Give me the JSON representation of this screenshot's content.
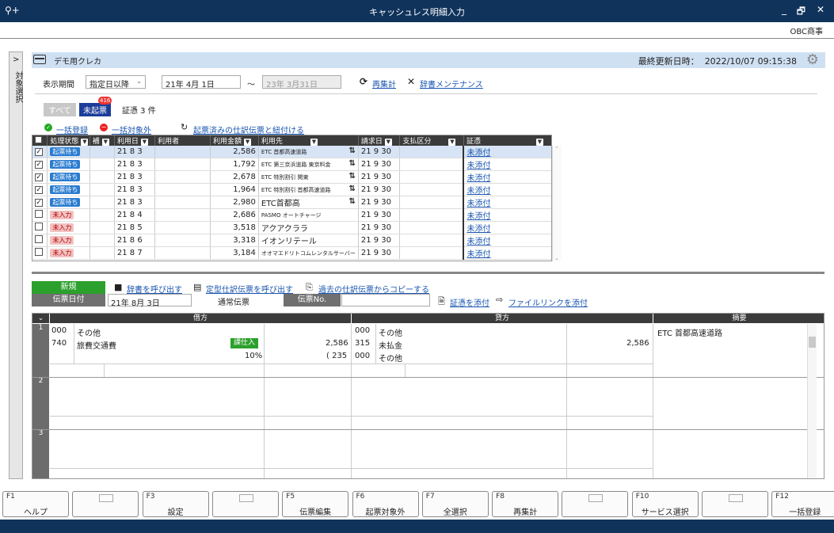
{
  "window": {
    "title": "キャッシュレス明細入力",
    "key_icon": "⚲+",
    "min": "_",
    "max": "🗗",
    "close": "✕"
  },
  "company": "OBC商事",
  "left_panel": {
    "chevron": ">",
    "label": "対象選択"
  },
  "header": {
    "card_name": "デモ用クレカ",
    "updated_label": "最終更新日時：",
    "updated_value": "2022/10/07 09:15:38"
  },
  "filter": {
    "period_label": "表示期間",
    "period_select": "指定日以降",
    "date_from": "21年 4月 1日",
    "tilde": "～",
    "date_to": "23年 3月31日",
    "recalc": "再集計",
    "dict": "辞書メンテナンス"
  },
  "status_tabs": {
    "all": "すべて",
    "unposted": "未起票",
    "unposted_count": "416",
    "evidence": "証憑 3 件"
  },
  "actions": {
    "bulk_register": "一括登録",
    "bulk_exclude": "一括対象外",
    "link_slip": "起票済みの仕訳伝票と紐付ける"
  },
  "grid": {
    "headers": [
      "処理状態",
      "補",
      "利用日",
      "利用者",
      "利用金額",
      "利用先",
      "請求日",
      "支払区分",
      "証憑"
    ],
    "rows": [
      {
        "checked": true,
        "status": "起票待ち",
        "st": "blue",
        "date": "21  8  3",
        "amount": "2,586",
        "payee": "ETC 首都高速道路",
        "sync": true,
        "bill": "21  9 30",
        "ev": "未添付"
      },
      {
        "checked": true,
        "status": "起票待ち",
        "st": "blue",
        "date": "21  8  3",
        "amount": "1,792",
        "payee": "ETC 第三京浜道路 東京料金",
        "sync": true,
        "bill": "21  9 30",
        "ev": "未添付"
      },
      {
        "checked": true,
        "status": "起票待ち",
        "st": "blue",
        "date": "21  8  3",
        "amount": "2,678",
        "payee": "ETC 特別割引 関東",
        "sync": true,
        "bill": "21  9 30",
        "ev": "未添付"
      },
      {
        "checked": true,
        "status": "起票待ち",
        "st": "blue",
        "date": "21  8  3",
        "amount": "1,964",
        "payee": "ETC 特別割引 首都高速道路",
        "sync": true,
        "bill": "21  9 30",
        "ev": "未添付"
      },
      {
        "checked": true,
        "status": "起票待ち",
        "st": "blue",
        "date": "21  8  3",
        "amount": "2,980",
        "payee": "ETC首都高",
        "sync": true,
        "bill": "21  9 30",
        "ev": "未添付"
      },
      {
        "checked": false,
        "status": "未入力",
        "st": "red",
        "date": "21  8  4",
        "amount": "2,686",
        "payee": "PASMO オートチャージ",
        "sync": false,
        "bill": "21  9 30",
        "ev": "未添付"
      },
      {
        "checked": false,
        "status": "未入力",
        "st": "red",
        "date": "21  8  5",
        "amount": "3,518",
        "payee": "アクアクララ",
        "sync": false,
        "bill": "21  9 30",
        "ev": "未添付"
      },
      {
        "checked": false,
        "status": "未入力",
        "st": "red",
        "date": "21  8  6",
        "amount": "3,318",
        "payee": "イオンリテール",
        "sync": false,
        "bill": "21  9 30",
        "ev": "未添付"
      },
      {
        "checked": false,
        "status": "未入力",
        "st": "red",
        "date": "21  8  7",
        "amount": "3,184",
        "payee": "オオマエドリトコムレンタルサーバー",
        "sync": false,
        "bill": "21  9 30",
        "ev": "未添付"
      }
    ]
  },
  "slip": {
    "new": "新規",
    "call_dict": "辞書を呼び出す",
    "call_template": "定型仕訳伝票を呼び出す",
    "copy_past": "過去の仕訳伝票からコピーする",
    "date_label": "伝票日付",
    "date_value": "21年 8月 3日",
    "type": "通常伝票",
    "no_label": "伝票No.",
    "attach_evidence": "証憑を添付",
    "attach_link": "ファイルリンクを添付"
  },
  "journal": {
    "headers": {
      "debit": "借方",
      "credit": "貸方",
      "memo": "摘要"
    },
    "row1": {
      "dr_code1": "000",
      "dr_name1": "その他",
      "dr_code2": "740",
      "dr_name2": "旅費交通費",
      "tax_badge": "課仕入",
      "dr_amount": "2,586",
      "tax_rate": "10%",
      "tax_amount": "( 235",
      "cr_code1": "000",
      "cr_name1": "その他",
      "cr_code2": "315",
      "cr_name2": "未払金",
      "cr_amount": "2,586",
      "cr_code3": "000",
      "cr_name3": "その他",
      "memo": "ETC 首都高速道路"
    },
    "row_nums": [
      "1",
      "2",
      "3"
    ]
  },
  "fkeys": [
    {
      "n": "F1",
      "l": "ヘルプ"
    },
    {
      "n": "",
      "l": "",
      "box": true
    },
    {
      "n": "F3",
      "l": "設定"
    },
    {
      "n": "",
      "l": "",
      "box": true
    },
    {
      "n": "F5",
      "l": "伝票編集"
    },
    {
      "n": "F6",
      "l": "起票対象外"
    },
    {
      "n": "F7",
      "l": "全選択"
    },
    {
      "n": "F8",
      "l": "再集計"
    },
    {
      "n": "",
      "l": "",
      "box": true
    },
    {
      "n": "F10",
      "l": "サービス選択"
    },
    {
      "n": "",
      "l": "",
      "box": true
    },
    {
      "n": "F12",
      "l": "一括登録"
    }
  ],
  "colors": {
    "titlebar": "#10335c",
    "header_bar": "#cfe0f3",
    "badge_blue": "#2a7cd0",
    "new_green": "#2ca02c"
  }
}
